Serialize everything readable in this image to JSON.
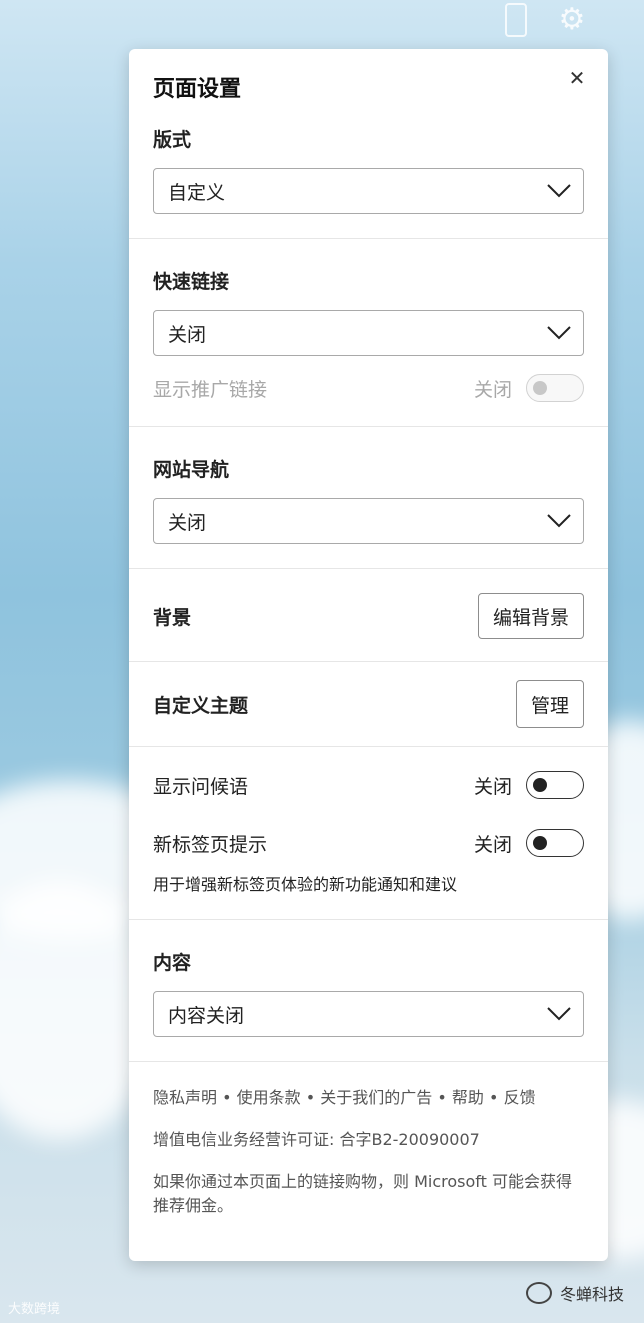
{
  "panel": {
    "title": "页面设置",
    "close_icon": "close-icon"
  },
  "layout_section": {
    "label": "版式",
    "selected": "自定义"
  },
  "quick_links": {
    "label": "快速链接",
    "selected": "关闭",
    "promoted_label": "显示推广链接",
    "promoted_state": "关闭"
  },
  "site_nav": {
    "label": "网站导航",
    "selected": "关闭"
  },
  "background": {
    "label": "背景",
    "button": "编辑背景"
  },
  "custom_theme": {
    "label": "自定义主题",
    "button": "管理"
  },
  "greeting": {
    "label": "显示问候语",
    "state": "关闭"
  },
  "new_tab_tips": {
    "label": "新标签页提示",
    "state": "关闭",
    "description": "用于增强新标签页体验的新功能通知和建议"
  },
  "content": {
    "label": "内容",
    "selected": "内容关闭"
  },
  "footer": {
    "links": [
      "隐私声明",
      "使用条款",
      "关于我们的广告",
      "帮助",
      "反馈"
    ],
    "separator": "•",
    "license": "增值电信业务经营许可证: 合字B2-20090007",
    "disclaimer": "如果你通过本页面上的链接购物，则 Microsoft 可能会获得推荐佣金。"
  },
  "watermarks": {
    "left": "大数跨境",
    "right": "冬蝉科技"
  },
  "colors": {
    "panel_bg": "#ffffff",
    "toggle_off_knob": "#222222",
    "disabled_text": "#a8a8a8"
  }
}
